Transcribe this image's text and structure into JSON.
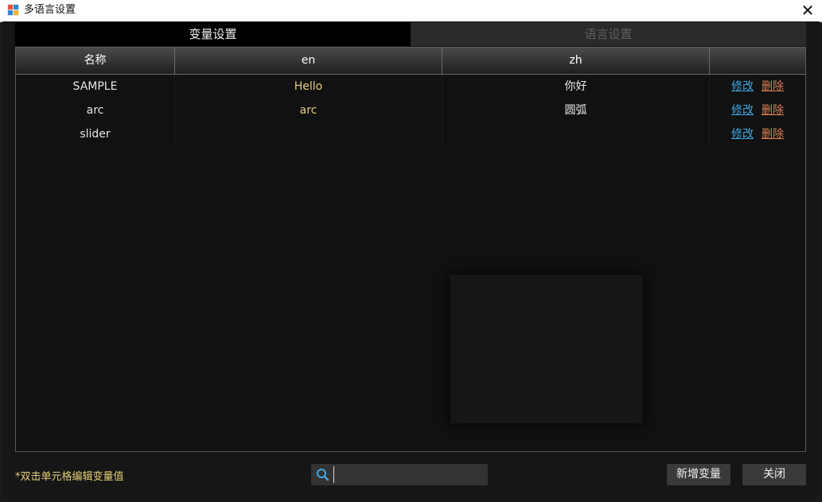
{
  "window": {
    "title": "多语言设置",
    "close_icon": "close-icon"
  },
  "tabs": [
    {
      "label": "变量设置",
      "active": true
    },
    {
      "label": "语言设置",
      "active": false
    }
  ],
  "table": {
    "columns": [
      "名称",
      "en",
      "zh",
      ""
    ],
    "rows": [
      {
        "name": "SAMPLE",
        "en": "Hello",
        "zh": "你好",
        "edit": "修改",
        "delete": "删除"
      },
      {
        "name": "arc",
        "en": "arc",
        "zh": "圆弧",
        "edit": "修改",
        "delete": "删除"
      },
      {
        "name": "slider",
        "en": "",
        "zh": "",
        "edit": "修改",
        "delete": "删除"
      }
    ]
  },
  "footer": {
    "hint": "*双击单元格编辑变量值",
    "search": {
      "value": "",
      "placeholder": "",
      "icon": "search-icon"
    },
    "add_button": "新增变量",
    "close_button": "关闭"
  },
  "colors": {
    "accent_link": "#3fa9e6",
    "delete_link": "#e0805a",
    "en_value": "#e6cf7a",
    "background": "#161616"
  }
}
